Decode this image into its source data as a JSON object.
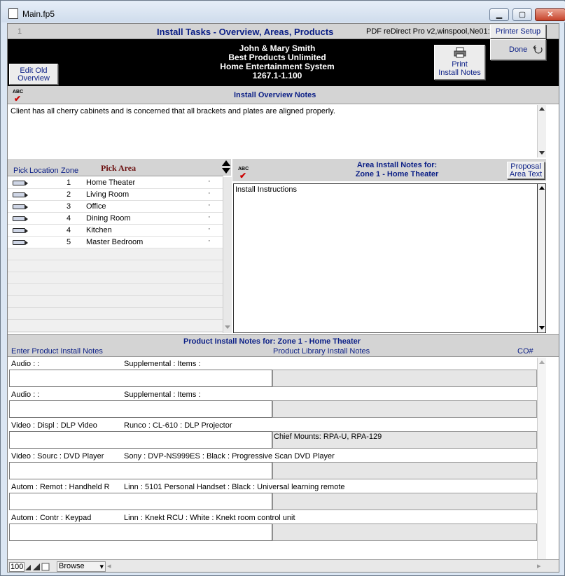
{
  "window": {
    "title": "Main.fp5",
    "min": "▁",
    "max": "▢",
    "close": "✕"
  },
  "header": {
    "record_num": "1",
    "title": "Install Tasks  - Overview, Areas, Products",
    "printer_info": "PDF reDirect Pro v2,winspool,Ne01:",
    "printer_setup": "Printer Setup",
    "done": "Done"
  },
  "banner": {
    "client": "John & Mary Smith",
    "company": "Best Products Unlimited",
    "system": "Home Entertainment System",
    "version": "1267.1-1.100",
    "edit_old_overview_1": "Edit Old",
    "edit_old_overview_2": "Overview",
    "print_label_1": "Print",
    "print_label_2": "Install Notes"
  },
  "overview": {
    "title": "Install Overview Notes",
    "text": "Client has all cherry cabinets and is concerned that all brackets and plates are aligned properly."
  },
  "areas": {
    "col_pick": "Pick",
    "col_location": "Location",
    "col_zone": "Zone",
    "title": "Pick Area",
    "rows": [
      {
        "zone": "1",
        "name": "Home Theater"
      },
      {
        "zone": "2",
        "name": "Living Room"
      },
      {
        "zone": "3",
        "name": "Office"
      },
      {
        "zone": "4",
        "name": "Dining Room"
      },
      {
        "zone": "4",
        "name": "Kitchen"
      },
      {
        "zone": "5",
        "name": "Master Bedroom"
      }
    ]
  },
  "area_notes": {
    "title_1": "Area Install Notes for:",
    "title_2": "Zone 1 - Home Theater",
    "proposal_1": "Proposal",
    "proposal_2": "Area Text",
    "text": "Install Instructions"
  },
  "products": {
    "title": "Product Install Notes for:  Zone 1 - Home Theater",
    "col_enter": "Enter Product Install Notes",
    "col_library": "Product Library Install Notes",
    "col_co": "CO#",
    "rows": [
      {
        "left": "Audio :  :",
        "right": "Supplemental : Items :",
        "library": ""
      },
      {
        "left": "Audio :  :",
        "right": "Supplemental : Items :",
        "library": ""
      },
      {
        "left": "Video : Displ : DLP Video",
        "right": "Runco : CL-610 : DLP Projector",
        "library": "Chief Mounts: RPA-U, RPA-129"
      },
      {
        "left": "Video : Sourc : DVD Player",
        "right": "Sony : DVP-NS999ES : Black : Progressive Scan DVD Player",
        "library": ""
      },
      {
        "left": "Autom : Remot : Handheld R",
        "right": "Linn : 5101 Personal Handset : Black : Universal learning remote",
        "library": ""
      },
      {
        "left": "Autom : Contr : Keypad",
        "right": "Linn : Knekt RCU : White : Knekt room control unit",
        "library": ""
      }
    ]
  },
  "statusbar": {
    "zoom": "100",
    "mode": "Browse"
  },
  "colors": {
    "accent": "#0b1f86",
    "maroon": "#6a0d0d",
    "banner": "#000000"
  },
  "icons": {
    "spell": "spellcheck-icon",
    "printer": "printer-icon",
    "done": "done-arrow-icon"
  }
}
